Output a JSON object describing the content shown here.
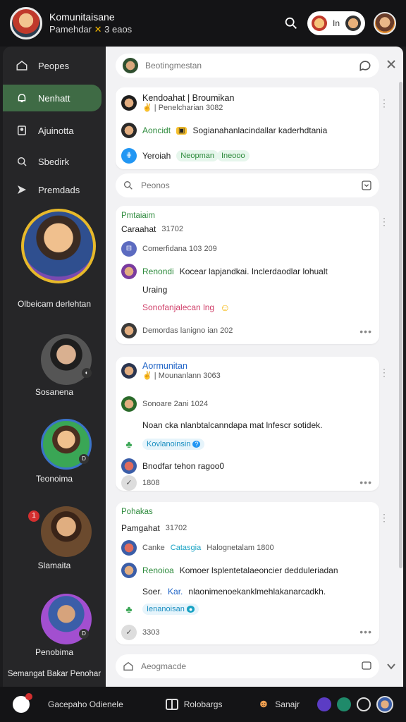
{
  "header": {
    "title": "Komunitaisane",
    "subtitle": "Pamehdar",
    "subtitle_tag": "3 eaos",
    "pill_label": "In"
  },
  "sidebar": {
    "items": [
      {
        "label": "Peopes",
        "icon": "home-icon"
      },
      {
        "label": "Nenhatt",
        "icon": "bell-icon",
        "active": true
      },
      {
        "label": "Ajuinotta",
        "icon": "user-icon"
      },
      {
        "label": "Sbedirk",
        "icon": "search-icon"
      },
      {
        "label": "Premdads",
        "icon": "send-icon"
      }
    ],
    "profiles": [
      {
        "caption": "Olbeicam derlehtan"
      },
      {
        "caption": "Sosanena"
      },
      {
        "caption": "Teonoima"
      },
      {
        "caption": "Slamaita"
      },
      {
        "caption": "Penobima"
      }
    ],
    "footer_caption": "Semangat Bakar Penohar",
    "badge_count": "1"
  },
  "main": {
    "top_input": "Beotingmestan",
    "card1": {
      "title": "Kendoahat | Broumikan",
      "meta": "Penelcharian 3082",
      "line_user": "Aoncidt",
      "line_text": "Sogianahanlacindallar kaderhdtania",
      "foot_text": "Yeroiah",
      "chip1": "Neopman",
      "chip2": "Ineooo"
    },
    "search_placeholder": "Peonos",
    "card2": {
      "tag": "Pmtaiaim",
      "title": "Caraahat",
      "title_num": "31702",
      "meta": "Comerfidana 103 209",
      "line_user": "Renondi",
      "line_text": "Kocear lapjandkai. Inclerdaodlar lohualt",
      "line_text2": "Uraing",
      "pink_text": "Sonofanjalecan lng",
      "foot": "Demordas lanigno ian 202"
    },
    "card3": {
      "title": "Aormunitan",
      "meta": "Mounanlann 3063",
      "line1": "Sonoare 2ani 1024",
      "line2": "Noan cka nlanbtalcanndapa mat lnfescr sotidek.",
      "chip": "Kovlanoinsin",
      "line3": "Bnodfar tehon ragoo0",
      "count": "1808"
    },
    "card4": {
      "tag": "Pohakas",
      "title": "Pamgahat",
      "title_num": "31702",
      "line1_a": "Canke",
      "line1_b": "Catasgia",
      "line1_c": "Halognetalam 1800",
      "line_user": "Renoioa",
      "line_text": "Komoer lsplentetalaeoncier dedduleriadan",
      "line2_a": "Soer.",
      "line2_b": "Kar.",
      "line2_c": "nlaonimenoekanklmehlakanarcadkh.",
      "chip": "Ienanoisan",
      "count": "3303"
    },
    "bottom_input": "Aeogmacde"
  },
  "bottombar": {
    "item1": "Gacepaho Odienele",
    "item2": "Rolobargs",
    "item3": "Sanajr"
  }
}
